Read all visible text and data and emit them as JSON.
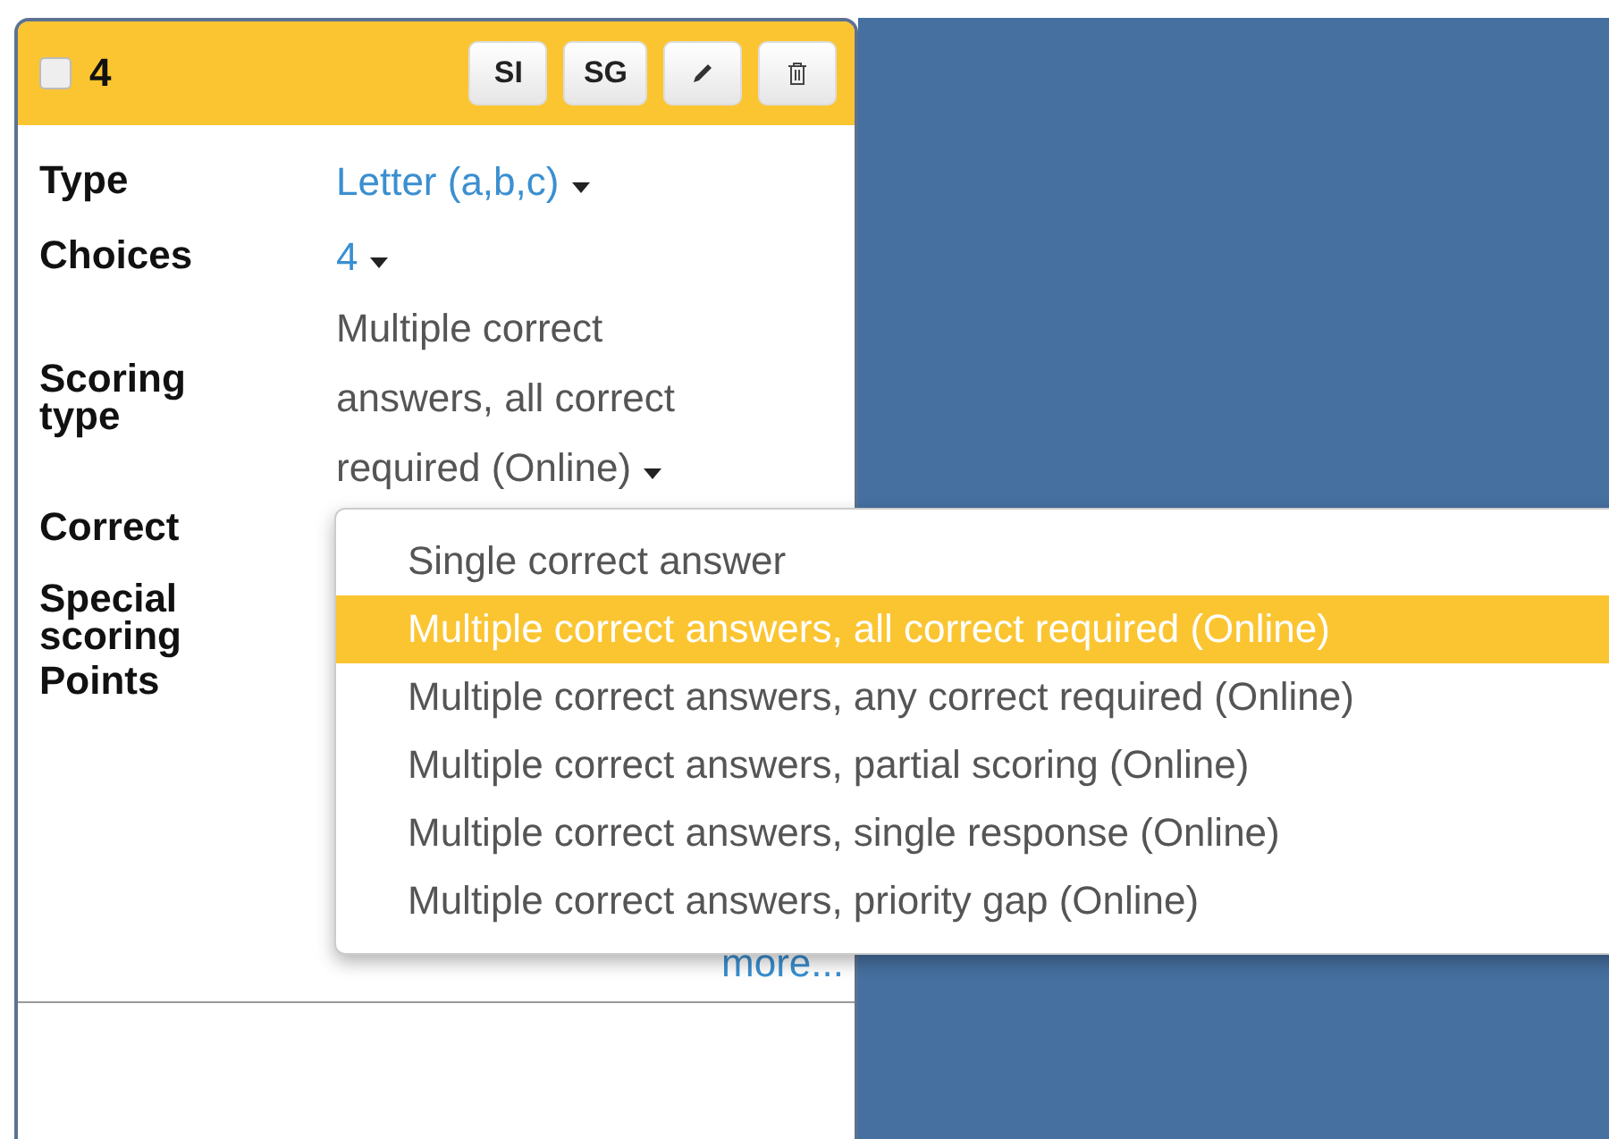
{
  "card": {
    "number": "4",
    "checked": false,
    "buttons": [
      {
        "kind": "text",
        "label": "SI"
      },
      {
        "kind": "text",
        "label": "SG"
      },
      {
        "kind": "edit"
      },
      {
        "kind": "delete"
      }
    ],
    "fields": [
      {
        "label": "Type",
        "value": "Letter (a,b,c)",
        "kind": "link"
      },
      {
        "label": "Choices",
        "value": "4",
        "kind": "link"
      },
      {
        "label": "Scoring type",
        "value": "Multiple correct answers, all correct required (Online)",
        "kind": "text"
      },
      {
        "label": "Correct",
        "kind": "hidden"
      },
      {
        "label": "Special scoring",
        "kind": "hidden"
      },
      {
        "label": "Points",
        "kind": "hidden"
      }
    ],
    "more_link": "more..."
  },
  "dropdown": {
    "options": [
      {
        "label": "Single correct answer",
        "selected": false
      },
      {
        "label": "Multiple correct answers, all correct required (Online)",
        "selected": true
      },
      {
        "label": "Multiple correct answers, any correct required (Online)",
        "selected": false
      },
      {
        "label": "Multiple correct answers, partial scoring (Online)",
        "selected": false
      },
      {
        "label": "Multiple correct answers, single response (Online)",
        "selected": false
      },
      {
        "label": "Multiple correct answers, priority gap (Online)",
        "selected": false
      }
    ]
  }
}
